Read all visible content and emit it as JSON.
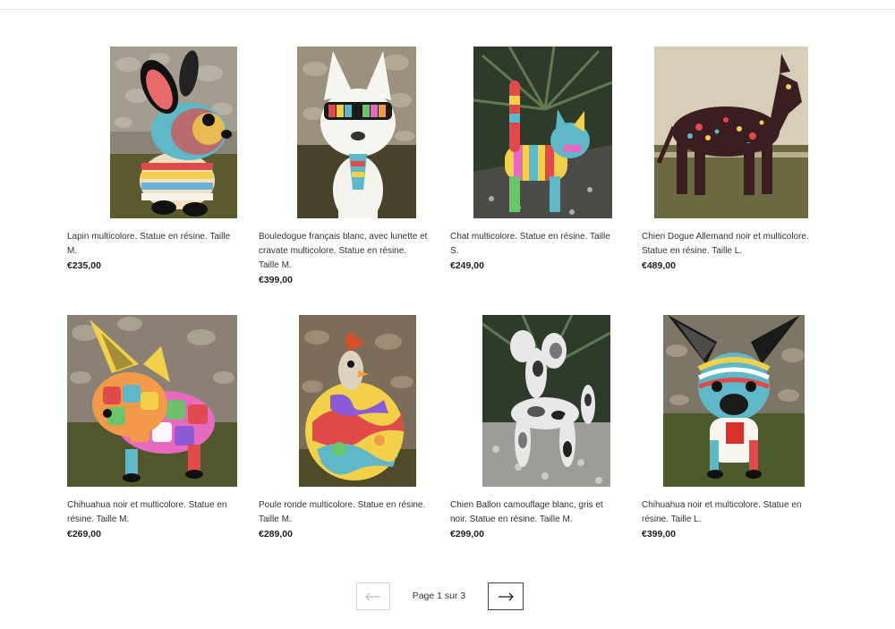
{
  "products": [
    {
      "title": "Lapin multicolore. Statue en résine. Taille M.",
      "price": "€235,00",
      "image_icon": "rabbit-statue-photo"
    },
    {
      "title": "Bouledogue français blanc, avec lunette et cravate multicolore. Statue en résine. Taille M.",
      "price": "€399,00",
      "image_icon": "bulldog-statue-photo"
    },
    {
      "title": "Chat multicolore. Statue en résine. Taille S.",
      "price": "€249,00",
      "image_icon": "cat-statue-photo"
    },
    {
      "title": "Chien Dogue Allemand noir et multicolore. Statue en résine. Taille L.",
      "price": "€489,00",
      "image_icon": "great-dane-statue-photo"
    },
    {
      "title": "Chihuahua noir et multicolore. Statue en résine. Taille M.",
      "price": "€269,00",
      "image_icon": "chihuahua-statue-photo"
    },
    {
      "title": "Poule ronde multicolore. Statue en résine. Taille M.",
      "price": "€289,00",
      "image_icon": "hen-statue-photo"
    },
    {
      "title": "Chien Ballon camouflage blanc, gris et noir. Statue en résine. Taille M.",
      "price": "€299,00",
      "image_icon": "balloon-dog-statue-photo"
    },
    {
      "title": "Chihuahua noir et multicolore. Statue en résine. Taille L.",
      "price": "€399,00",
      "image_icon": "chihuahua-large-statue-photo"
    }
  ],
  "pagination": {
    "label": "Page 1 sur 3",
    "prev_icon": "arrow-left-icon",
    "next_icon": "arrow-right-icon"
  }
}
